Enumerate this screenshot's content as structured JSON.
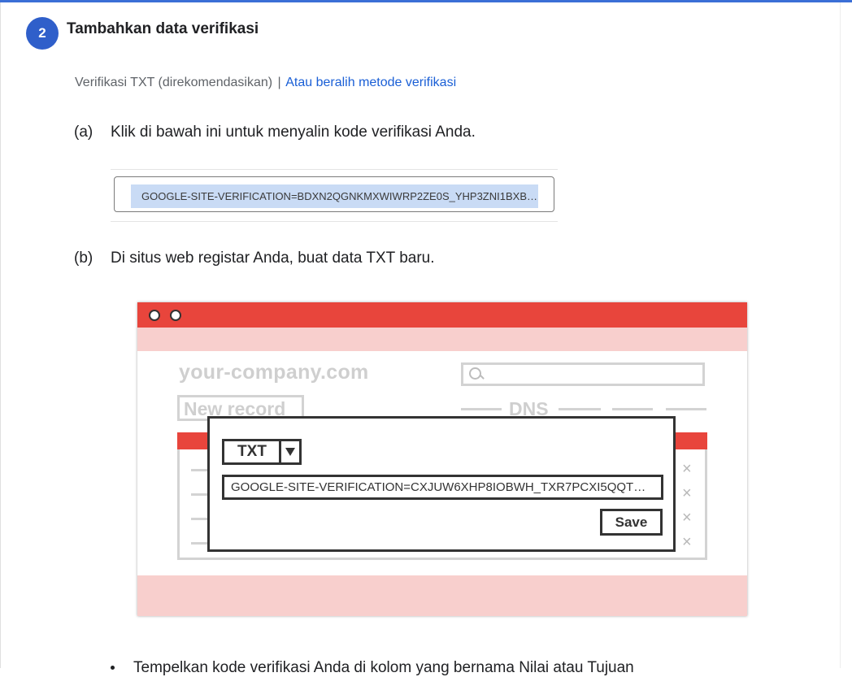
{
  "step": {
    "number": "2",
    "title": "Tambahkan data verifikasi"
  },
  "method": {
    "current": "Verifikasi TXT (direkomendasikan)",
    "separator": "|",
    "switch_link": "Atau beralih metode verifikasi"
  },
  "sub_a": {
    "label": "(a)",
    "text": "Klik di bawah ini untuk menyalin kode verifikasi Anda.",
    "code": "GOOGLE-SITE-VERIFICATION=BDXN2QGNKMXWIWRP2ZE0S_YHP3ZNI1BXB…"
  },
  "sub_b": {
    "label": "(b)",
    "text": "Di situs web registar Anda, buat data TXT baru."
  },
  "illustration": {
    "domain": "your-company.com",
    "new_record": "New record",
    "dns": "DNS",
    "record_type": "TXT",
    "value": "GOOGLE-SITE-VERIFICATION=CXJUW6XHP8IOBWH_TXR7PCXI5QQT…",
    "save": "Save",
    "remove_icon": "×"
  },
  "instructions": {
    "bullet_1": "Tempelkan kode verifikasi Anda di kolom yang bernama Nilai atau Tujuan"
  },
  "colors": {
    "accent": "#2f5fca",
    "link": "#1a5fd6",
    "illustration_red": "#e8453c",
    "illustration_pink": "#f8cfcd"
  }
}
